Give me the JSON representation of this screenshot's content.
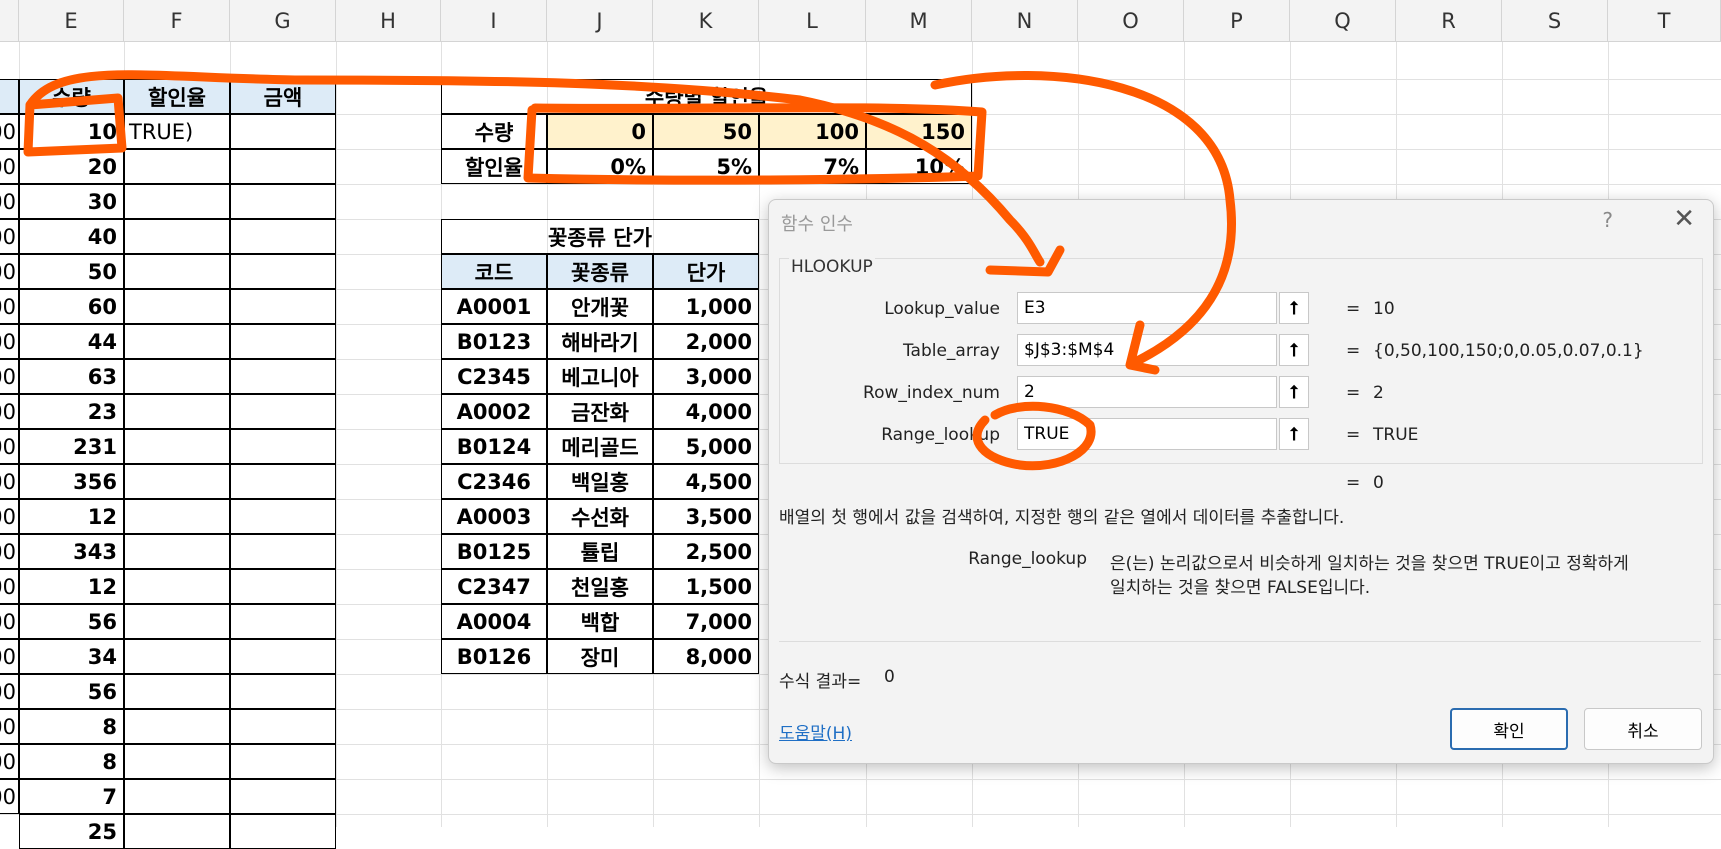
{
  "column_headers": [
    "E",
    "F",
    "G",
    "H",
    "I",
    "J",
    "K",
    "L",
    "M",
    "N",
    "O",
    "P",
    "Q",
    "R",
    "S",
    "T"
  ],
  "qty_table": {
    "headers": [
      "수량",
      "할인율",
      "금액"
    ],
    "qty_values": [
      "10",
      "20",
      "30",
      "40",
      "50",
      "60",
      "44",
      "63",
      "23",
      "231",
      "356",
      "12",
      "343",
      "12",
      "56",
      "34",
      "56",
      "8",
      "8",
      "7",
      "25"
    ],
    "left_clip": [
      "00",
      "00",
      "00",
      "00",
      "00",
      "00",
      "00",
      "00",
      "00",
      "00",
      "00",
      "00",
      "00",
      "00",
      "00",
      "00",
      "00",
      "00",
      "00",
      "00"
    ],
    "f3_value": "TRUE)"
  },
  "discount_table": {
    "title": "수량별 할인율",
    "row1_label": "수량",
    "row2_label": "할인율",
    "qty": [
      "0",
      "50",
      "100",
      "150"
    ],
    "rate": [
      "0%",
      "5%",
      "7%",
      "10%"
    ]
  },
  "flower_table": {
    "title": "꽃종류 단가",
    "headers": [
      "코드",
      "꽃종류",
      "단가"
    ],
    "rows": [
      [
        "A0001",
        "안개꽃",
        "1,000"
      ],
      [
        "B0123",
        "해바라기",
        "2,000"
      ],
      [
        "C2345",
        "베고니아",
        "3,000"
      ],
      [
        "A0002",
        "금잔화",
        "4,000"
      ],
      [
        "B0124",
        "메리골드",
        "5,000"
      ],
      [
        "C2346",
        "백일홍",
        "4,500"
      ],
      [
        "A0003",
        "수선화",
        "3,500"
      ],
      [
        "B0125",
        "튤립",
        "2,500"
      ],
      [
        "C2347",
        "천일홍",
        "1,500"
      ],
      [
        "A0004",
        "백합",
        "7,000"
      ],
      [
        "B0126",
        "장미",
        "8,000"
      ]
    ]
  },
  "dialog": {
    "title": "함수 인수",
    "help_symbol": "?",
    "close_symbol": "✕",
    "function_name": "HLOOKUP",
    "args": [
      {
        "label": "Lookup_value",
        "value": "E3",
        "result": "10"
      },
      {
        "label": "Table_array",
        "value": "$J$3:$M$4",
        "result": "{0,50,100,150;0,0.05,0.07,0.1}"
      },
      {
        "label": "Row_index_num",
        "value": "2",
        "result": "2"
      },
      {
        "label": "Range_lookup",
        "value": "TRUE",
        "result": "TRUE"
      }
    ],
    "eq_sign": "=",
    "overall_result": "0",
    "description": "배열의 첫 행에서 값을 검색하여, 지정한 행의 같은 열에서 데이터를 추출합니다.",
    "arg_help_name": "Range_lookup",
    "arg_help_line1": "은(는) 논리값으로서 비슷하게 일치하는 것을 찾으면 TRUE이고 정확하게",
    "arg_help_line2": "일치하는 것을 찾으면 FALSE입니다.",
    "formula_result_label": "수식 결과=",
    "formula_result_value": "0",
    "help_link": "도움말(H)",
    "ok_label": "확인",
    "cancel_label": "취소",
    "collapse_icon": "⭡"
  },
  "colors": {
    "header_fill": "#ddebf7",
    "yellow_fill": "#fff2cc",
    "annotation": "#ff5a00",
    "link": "#1f6fc5"
  }
}
